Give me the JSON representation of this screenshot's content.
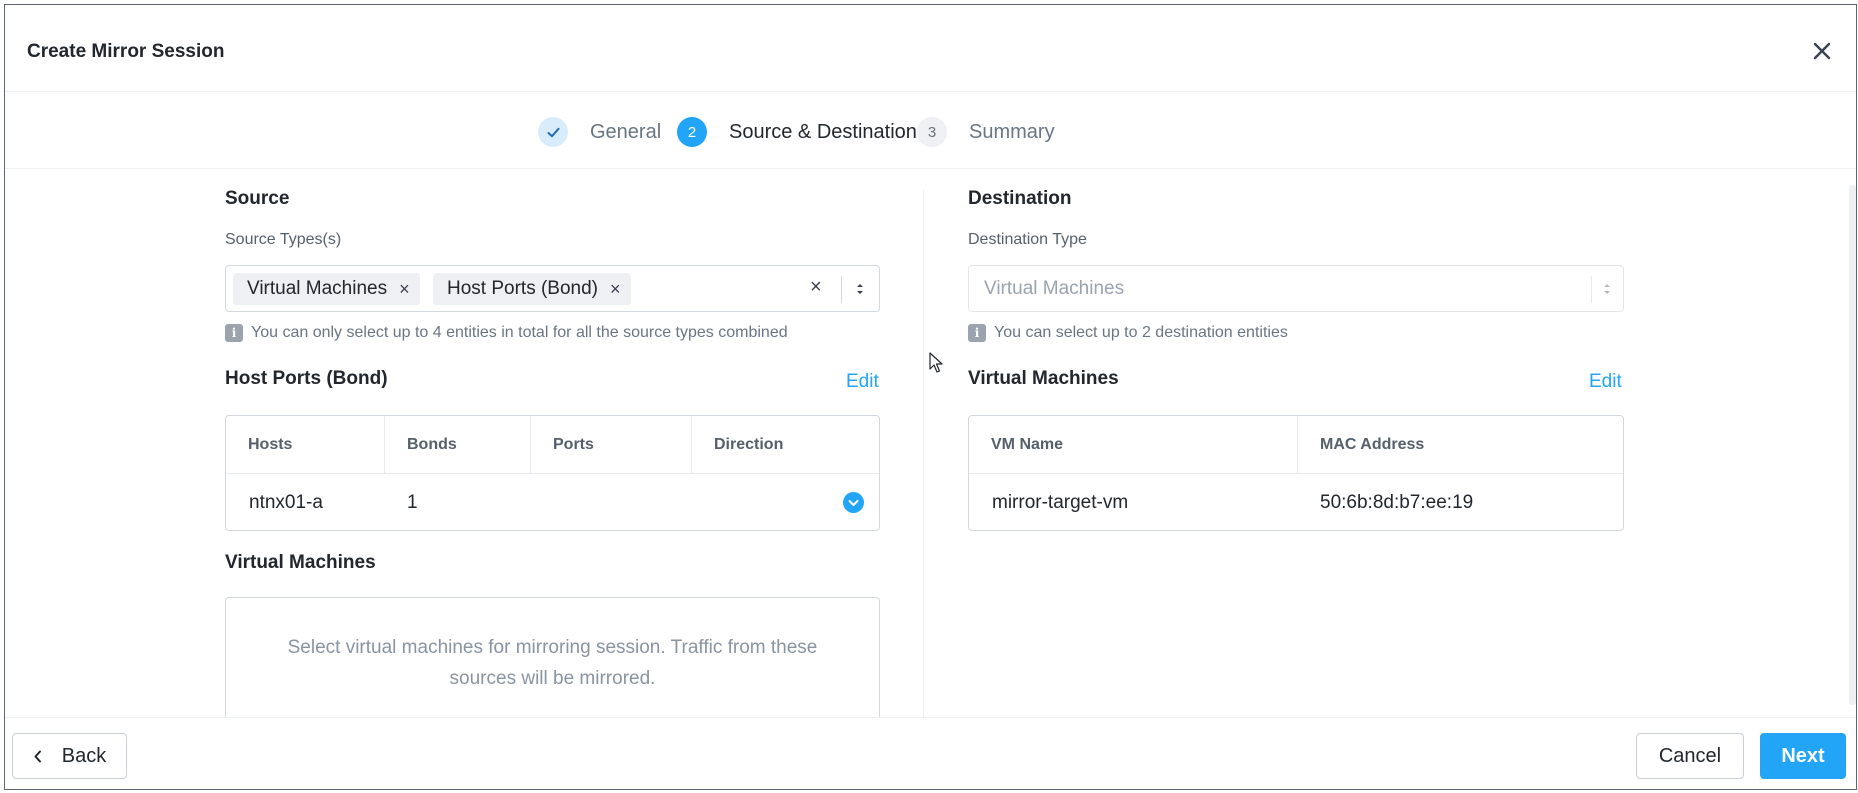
{
  "dialog": {
    "title": "Create Mirror Session"
  },
  "steps": [
    {
      "label": "General",
      "state": "done",
      "marker": "✓"
    },
    {
      "label": "Source & Destination",
      "state": "active",
      "marker": "2"
    },
    {
      "label": "Summary",
      "state": "todo",
      "marker": "3"
    }
  ],
  "source": {
    "title": "Source",
    "types_label": "Source Types(s)",
    "chips": [
      "Virtual Machines",
      "Host Ports (Bond)"
    ],
    "hint": "You can only select up to 4 entities in total for all the source types combined",
    "host_ports": {
      "title": "Host Ports (Bond)",
      "edit_label": "Edit",
      "columns": [
        "Hosts",
        "Bonds",
        "Ports",
        "Direction"
      ],
      "rows": [
        {
          "host": "ntnx01-a",
          "bonds": "1",
          "ports": "",
          "direction": ""
        }
      ]
    },
    "virtual_machines": {
      "title": "Virtual Machines",
      "empty_text": "Select virtual machines for mirroring session. Traffic from these sources will be mirrored."
    }
  },
  "destination": {
    "title": "Destination",
    "type_label": "Destination Type",
    "type_value": "Virtual Machines",
    "hint": "You can select up to 2 destination entities",
    "virtual_machines": {
      "title": "Virtual Machines",
      "edit_label": "Edit",
      "columns": [
        "VM Name",
        "MAC Address"
      ],
      "rows": [
        {
          "vm_name": "mirror-target-vm",
          "mac": "50:6b:8d:b7:ee:19"
        }
      ]
    }
  },
  "footer": {
    "back_label": "Back",
    "cancel_label": "Cancel",
    "next_label": "Next"
  },
  "icons": {
    "close": "close-icon",
    "check": "check-icon",
    "info": "info-icon",
    "chevron_left": "chevron-left-icon",
    "chevron_down": "chevron-down-icon",
    "sort_arrows": "sort-arrows-icon"
  },
  "colors": {
    "accent": "#22a5f7",
    "text": "#22272e",
    "muted": "#6a7584",
    "border": "#d3d8de"
  }
}
